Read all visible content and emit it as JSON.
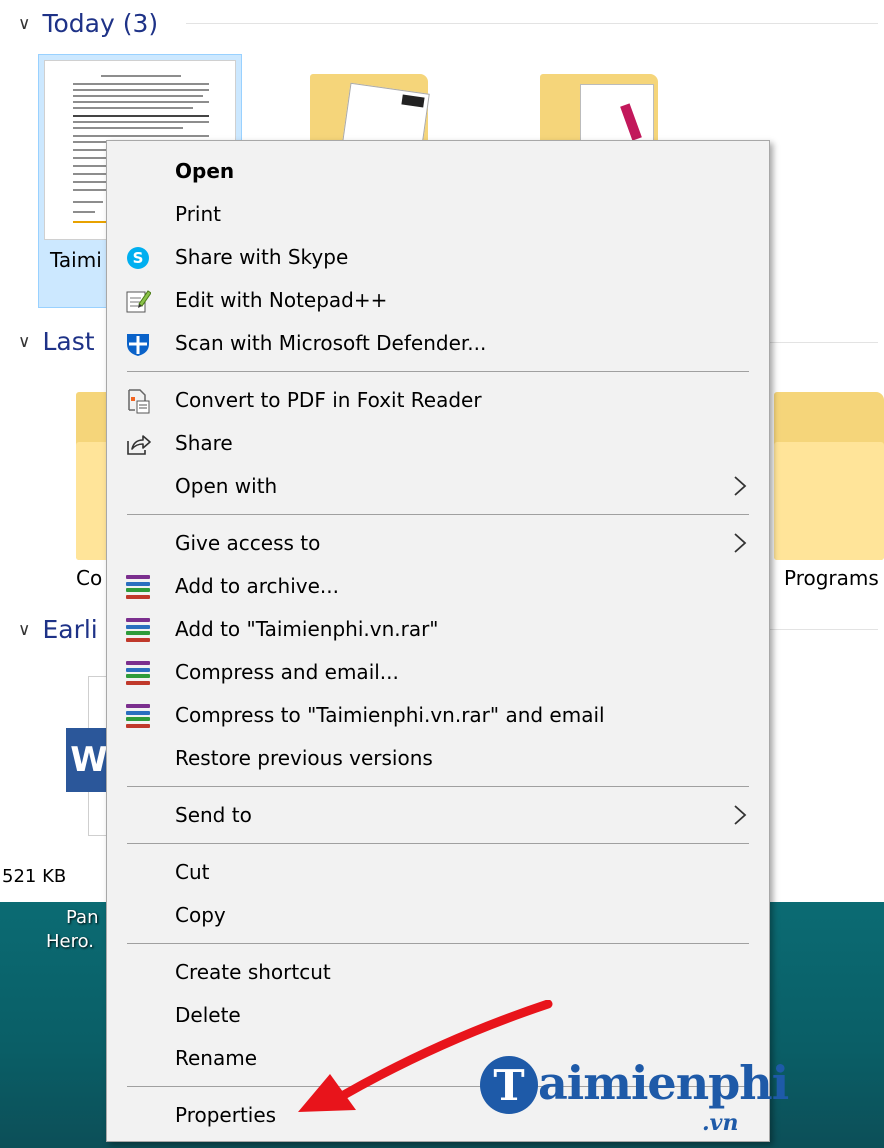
{
  "explorer": {
    "groups": [
      {
        "label": "Today (3)"
      },
      {
        "label": "Last"
      },
      {
        "label": "Earli"
      }
    ],
    "selected_file_label": "Taimi",
    "folder_labels": [
      "Co",
      "Programs"
    ],
    "file_size": "521 KB",
    "desktop_icon_label": [
      "Pan",
      "Hero."
    ]
  },
  "menu": {
    "items": [
      {
        "label": "Open",
        "icon": "none",
        "bold": true
      },
      {
        "label": "Print",
        "icon": "none"
      },
      {
        "label": "Share with Skype",
        "icon": "skype-icon"
      },
      {
        "label": "Edit with Notepad++",
        "icon": "notepadpp-icon"
      },
      {
        "label": "Scan with Microsoft Defender...",
        "icon": "defender-icon"
      },
      {
        "label": "Convert to PDF in Foxit Reader",
        "icon": "foxit-icon"
      },
      {
        "label": "Share",
        "icon": "share-icon"
      },
      {
        "label": "Open with",
        "icon": "none",
        "submenu": true
      },
      {
        "label": "Give access to",
        "icon": "none",
        "submenu": true
      },
      {
        "label": "Add to archive...",
        "icon": "winrar-icon"
      },
      {
        "label": "Add to \"Taimienphi.vn.rar\"",
        "icon": "winrar-icon"
      },
      {
        "label": "Compress and email...",
        "icon": "winrar-icon"
      },
      {
        "label": "Compress to \"Taimienphi.vn.rar\" and email",
        "icon": "winrar-icon"
      },
      {
        "label": "Restore previous versions",
        "icon": "none"
      },
      {
        "label": "Send to",
        "icon": "none",
        "submenu": true
      },
      {
        "label": "Cut",
        "icon": "none"
      },
      {
        "label": "Copy",
        "icon": "none"
      },
      {
        "label": "Create shortcut",
        "icon": "none"
      },
      {
        "label": "Delete",
        "icon": "none"
      },
      {
        "label": "Rename",
        "icon": "none"
      },
      {
        "label": "Properties",
        "icon": "none"
      }
    ]
  },
  "watermark": {
    "logo_letter": "T",
    "brand": "aimienphi",
    "suffix": ".vn"
  },
  "colors": {
    "menu_bg": "#f2f2f2",
    "selection": "#cce8ff",
    "header_text": "#1e3287",
    "desktop": "#0b6b73",
    "arrow": "#e8141b",
    "brand": "#1e5aa8"
  }
}
